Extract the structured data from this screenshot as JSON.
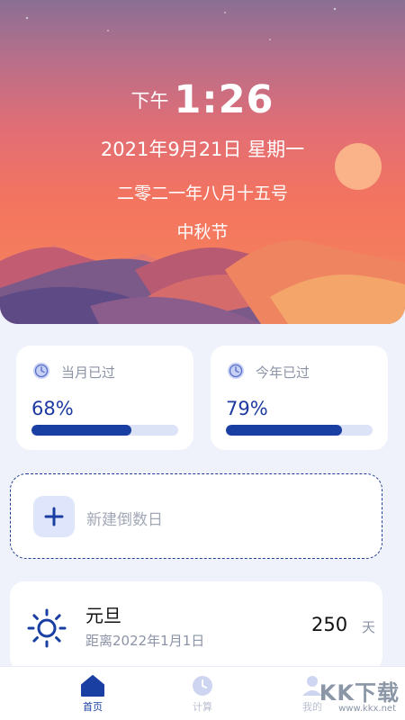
{
  "header": {
    "ampm": "下午",
    "time": "1:26",
    "date": "2021年9月21日 星期一",
    "lunar_date": "二零二一年八月十五号",
    "festival": "中秋节"
  },
  "stats": [
    {
      "label": "当月已过",
      "value_text": "68%",
      "fraction": 0.68
    },
    {
      "label": "今年已过",
      "value_text": "79%",
      "fraction": 0.79
    }
  ],
  "new_countdown": {
    "label": "新建倒数日"
  },
  "events": [
    {
      "title": "元旦",
      "subtitle": "距离2022年1月1日",
      "days": "250",
      "unit": "天"
    }
  ],
  "tabs": [
    {
      "label": "首页",
      "icon": "home-icon",
      "active": true
    },
    {
      "label": "计算",
      "icon": "clock-icon",
      "active": false
    },
    {
      "label": "我的",
      "icon": "person-icon",
      "active": false
    }
  ],
  "watermark": {
    "main": "KK下载",
    "sub": "www.kkx.net"
  },
  "colors": {
    "accent": "#1a3fa3",
    "progress_track": "#dde3f6",
    "hero_top": "#8a6f94",
    "hero_bottom": "#f6875c",
    "page_bg": "#eff2fb"
  }
}
